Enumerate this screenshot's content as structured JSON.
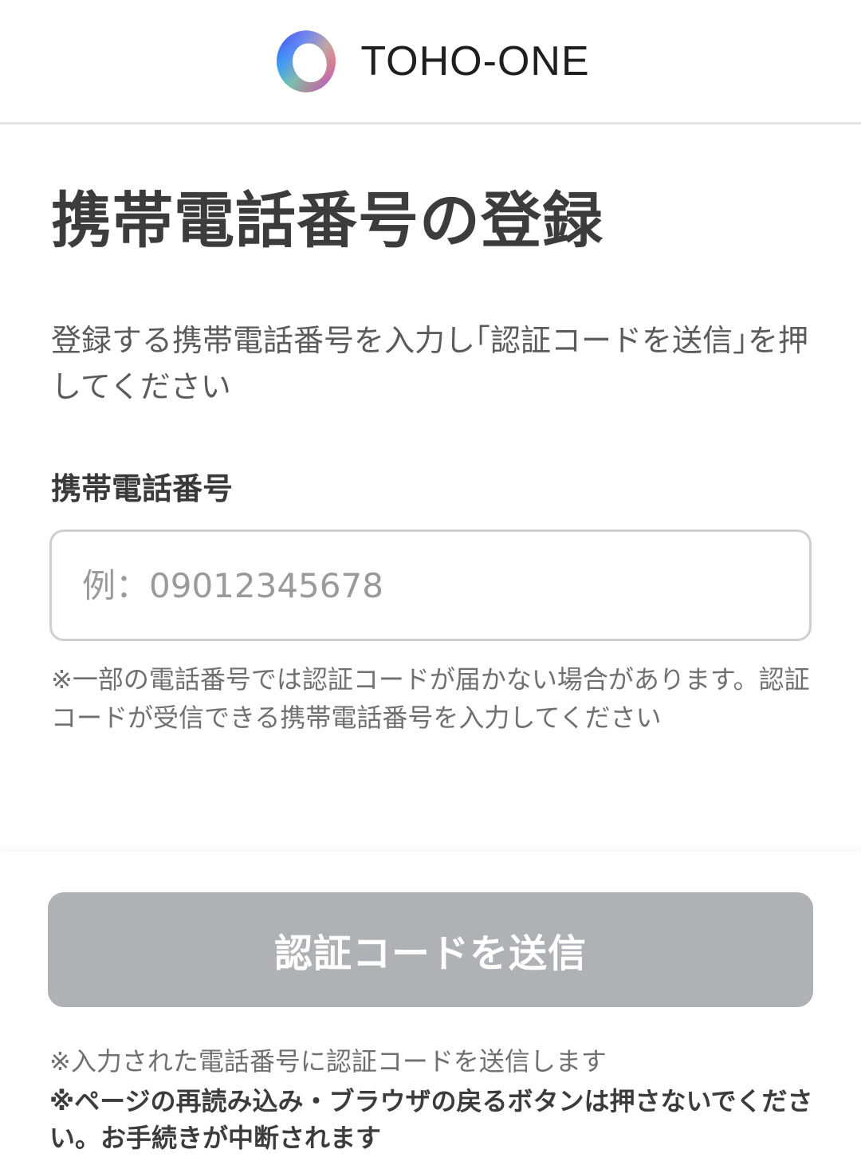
{
  "header": {
    "logo_text": "TOHO-ONE",
    "logo_icon": "toho-one-ring-logo"
  },
  "main": {
    "title": "携帯電話番号の登録",
    "lead": "登録する携帯電話番号を入力し｢認証コードを送信｣を押してください",
    "field_label": "携帯電話番号",
    "phone_input": {
      "value": "",
      "placeholder": "例：09012345678"
    },
    "notice": "※一部の電話番号では認証コードが届かない場合があります。認証コードが受信できる携帯電話番号を入力してください"
  },
  "footer": {
    "submit_label": "認証コードを送信",
    "submit_state": "disabled",
    "note_send": "※入力された電話番号に認証コードを送信します",
    "note_warning": "※ページの再読み込み・ブラウザの戻るボタンは押さないでください。お手続きが中断されます"
  },
  "colors": {
    "button_disabled": "#b0b1b5",
    "input_border": "#cfcfcf",
    "title_text": "#3c3c3c"
  }
}
